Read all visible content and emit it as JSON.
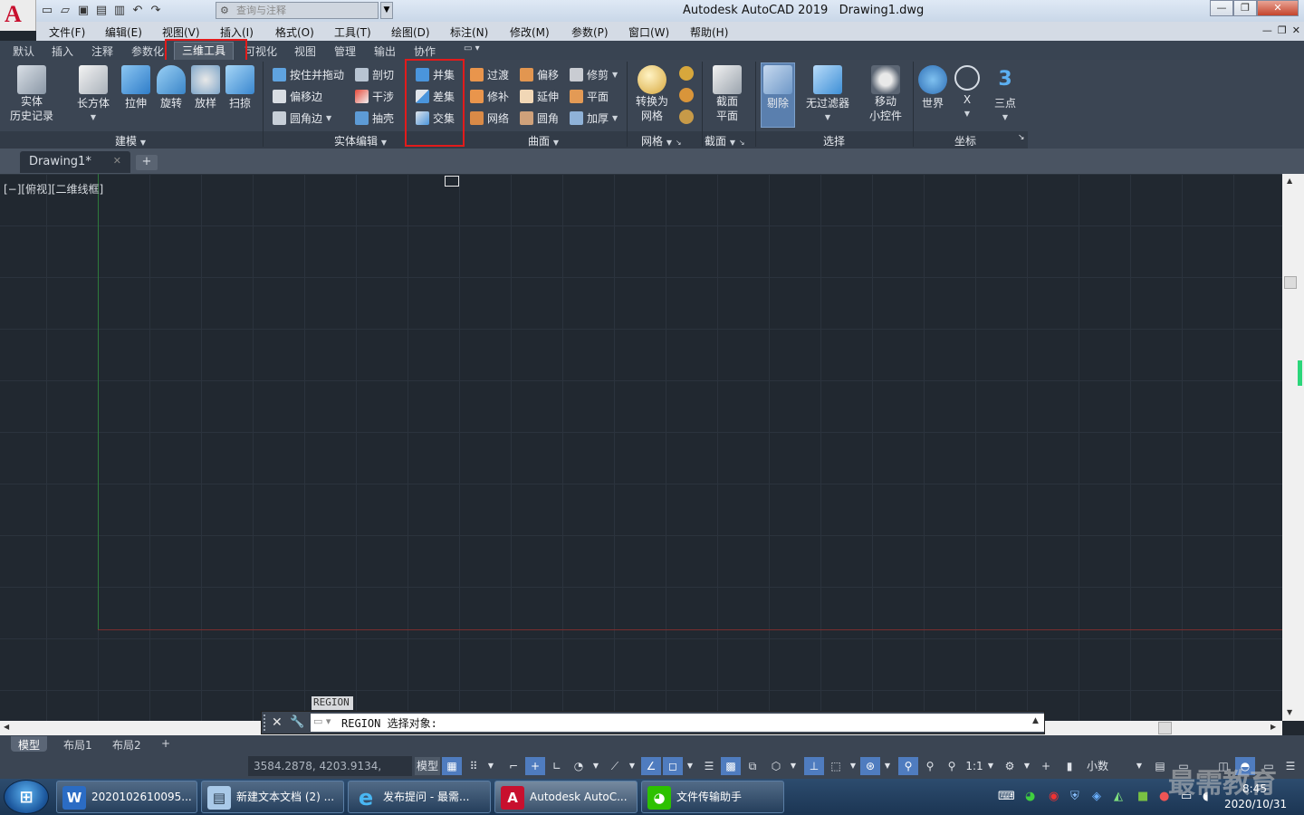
{
  "app": {
    "logo": "A",
    "title": "Autodesk AutoCAD 2019",
    "doc": "Drawing1.dwg",
    "search_placeholder": "查询与注释"
  },
  "menu": [
    "文件(F)",
    "编辑(E)",
    "视图(V)",
    "插入(I)",
    "格式(O)",
    "工具(T)",
    "绘图(D)",
    "标注(N)",
    "修改(M)",
    "参数(P)",
    "窗口(W)",
    "帮助(H)"
  ],
  "tabs": [
    "默认",
    "插入",
    "注释",
    "参数化",
    "三维工具",
    "可视化",
    "视图",
    "管理",
    "输出",
    "协作"
  ],
  "active_tab": "三维工具",
  "ribbon": {
    "modeling": {
      "label": "建模",
      "history": "实体\n历史记录",
      "box": "长方体",
      "extrude": "拉伸",
      "revolve": "旋转",
      "loft": "放样",
      "sweep": "扫掠"
    },
    "solid_edit": {
      "label": "实体编辑",
      "presspull": "按住并拖动",
      "slice": "剖切",
      "offset_edge": "偏移边",
      "interfere": "干涉",
      "fillet_edge": "圆角边",
      "shell": "抽壳"
    },
    "boolean": {
      "union": "并集",
      "subtract": "差集",
      "intersect": "交集"
    },
    "surface": {
      "label": "曲面",
      "blend": "过渡",
      "offset": "偏移",
      "trim": "修剪",
      "patch": "修补",
      "extend": "延伸",
      "planar": "平面",
      "network": "网络",
      "fillet": "圆角",
      "thicken": "加厚"
    },
    "mesh": {
      "label": "网格",
      "convert": "转换为\n网格"
    },
    "section": {
      "label": "截面",
      "plane": "截面\n平面"
    },
    "selection": {
      "label": "选择",
      "cull": "剔除",
      "nofilter": "无过滤器",
      "gizmo": "移动\n小控件"
    },
    "ucs": {
      "label": "坐标",
      "world": "世界",
      "x": "X",
      "three": "三点"
    }
  },
  "doc_tab": "Drawing1*",
  "viewport_label": "[−][俯视][二维线框]",
  "command": {
    "history": "REGION",
    "prompt": "REGION 选择对象:"
  },
  "layout_tabs": [
    "模型",
    "布局1",
    "布局2"
  ],
  "status": {
    "coords": "3584.2878, 4203.9134, 0.0000",
    "model": "模型",
    "scale": "1:1",
    "units": "小数"
  },
  "taskbar": {
    "items": [
      "2020102610095...",
      "新建文本文档 (2) ...",
      "发布提问 - 最需...",
      "Autodesk AutoC...",
      "文件传输助手"
    ],
    "time": "8:45",
    "date": "2020/10/31",
    "watermark": "最需教育"
  },
  "colors": {
    "highlight_box": "#e21b1b",
    "canvas": "#212830",
    "ribbon": "#3b4553"
  }
}
